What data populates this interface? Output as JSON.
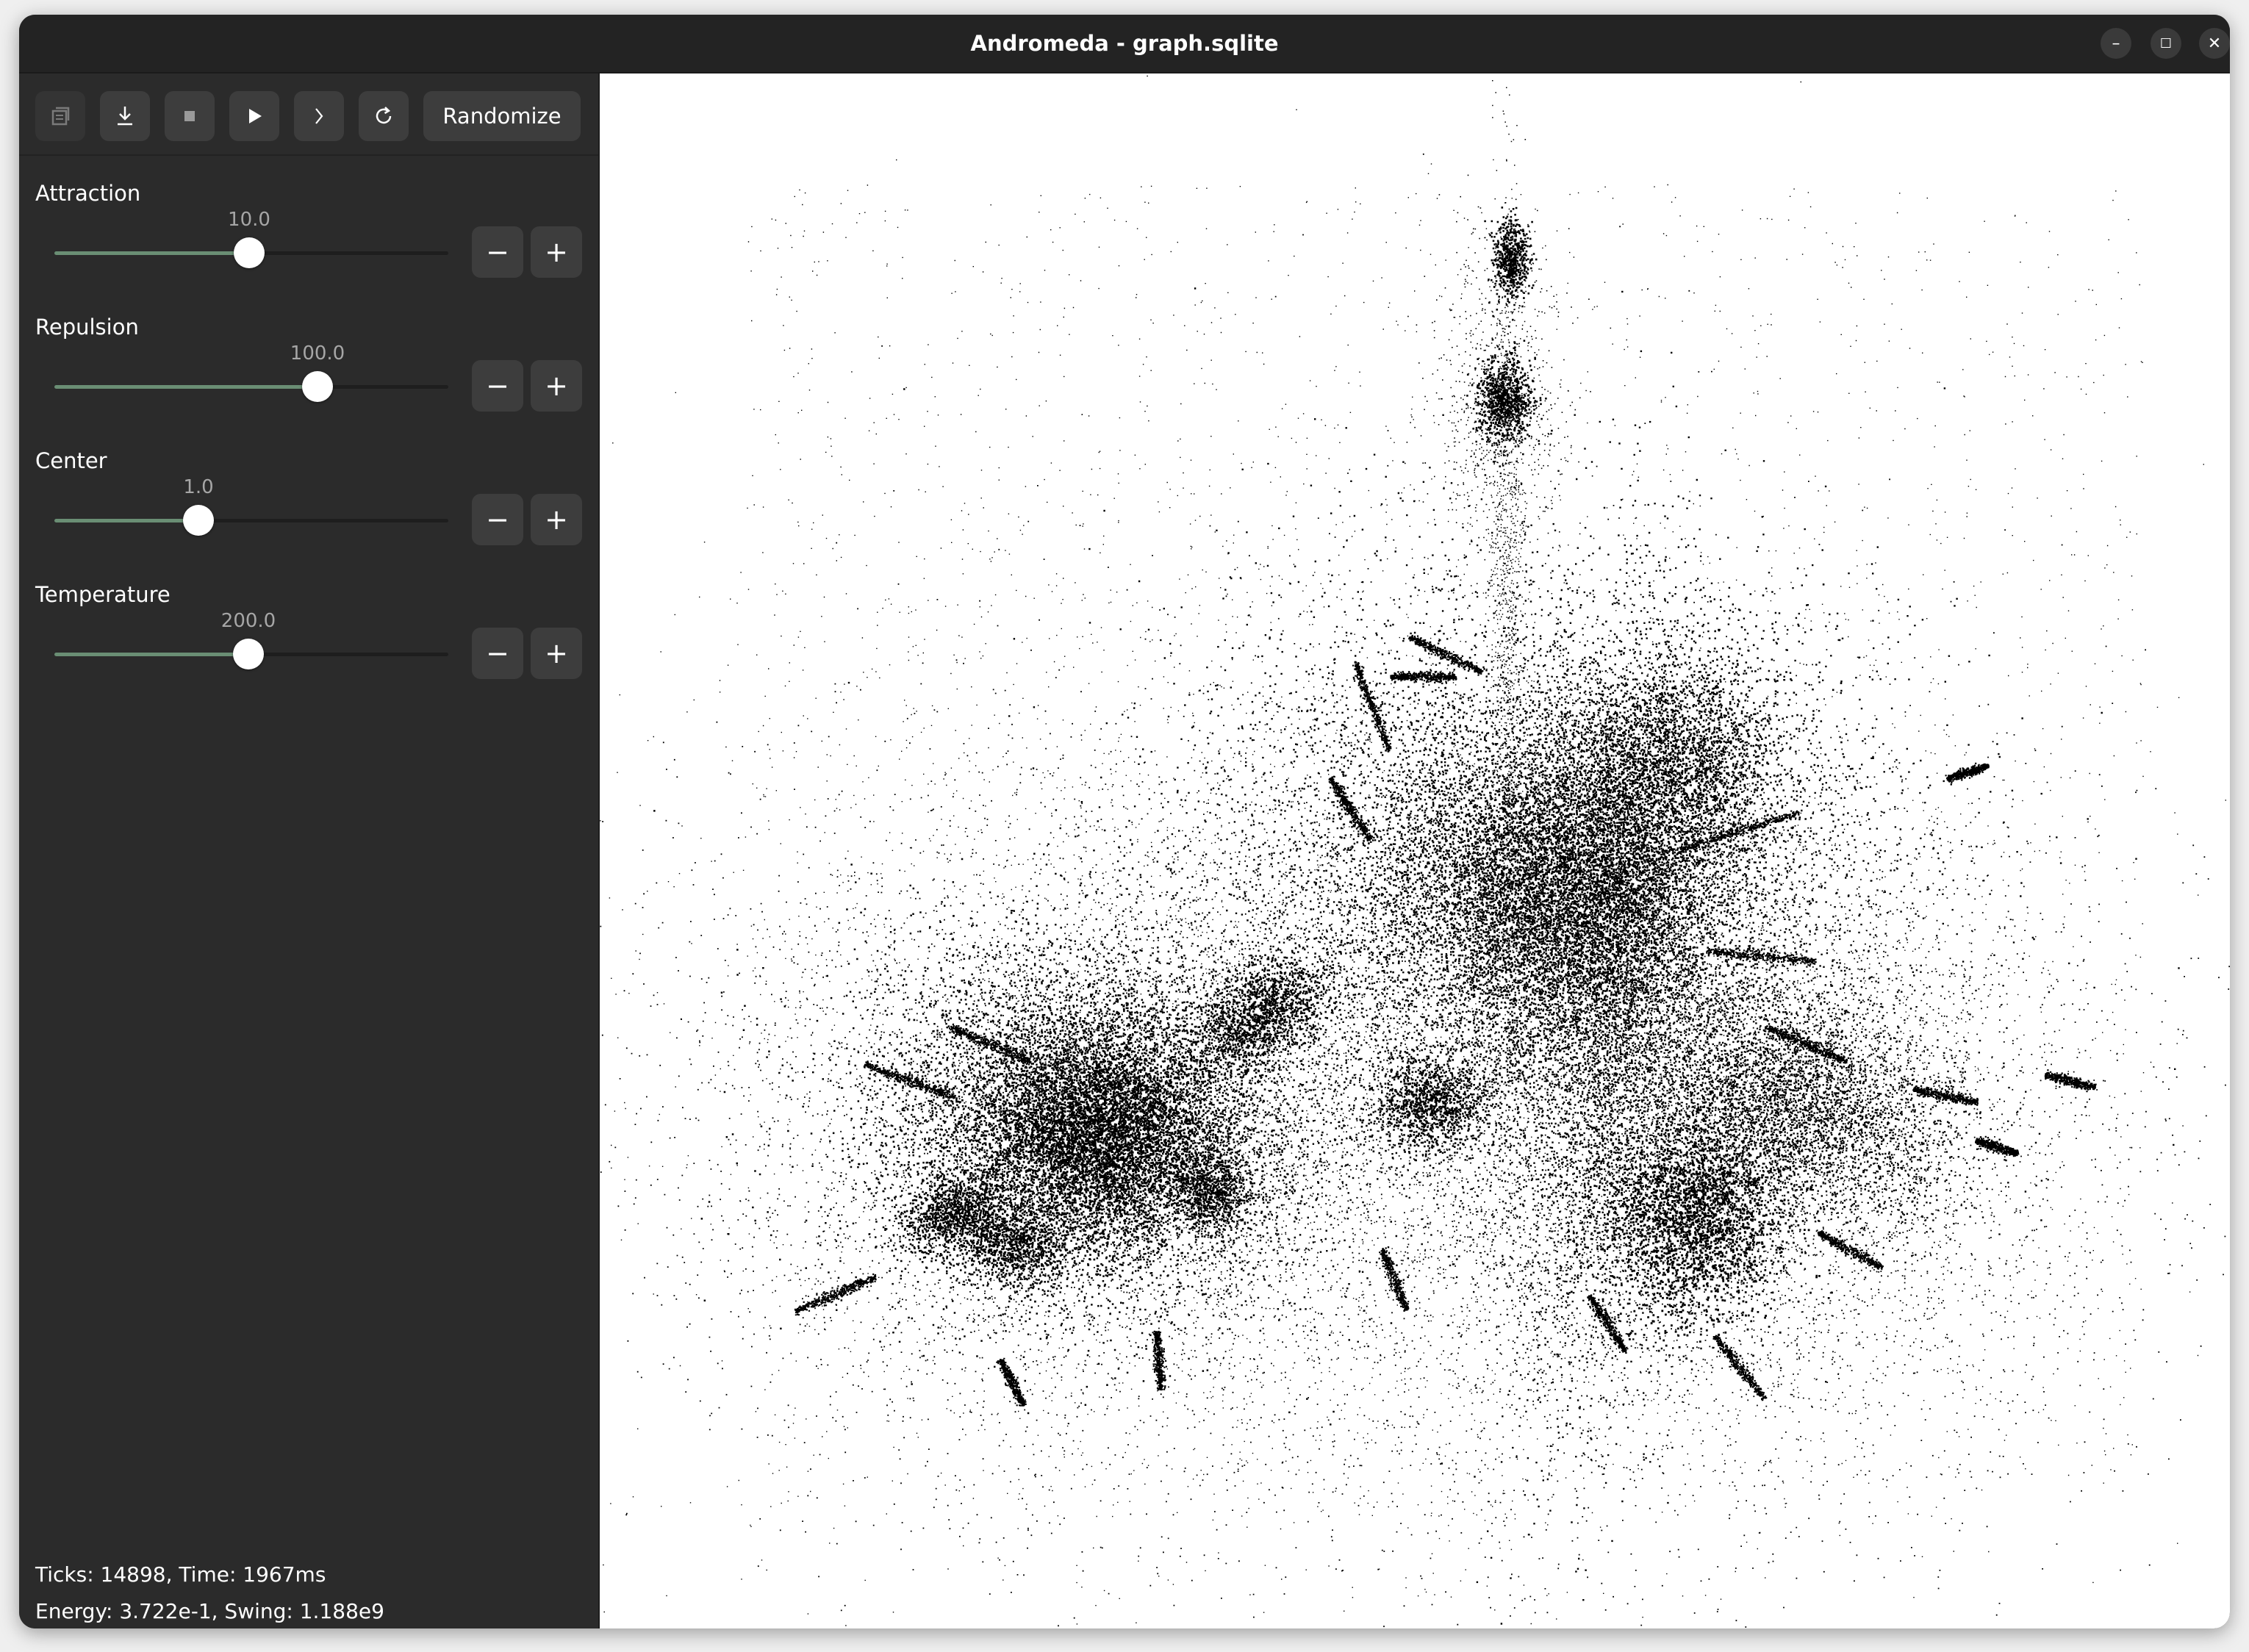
{
  "window": {
    "title": "Andromeda - graph.sqlite",
    "controls": {
      "minimize": "–",
      "maximize": "☐",
      "close": "✕"
    }
  },
  "toolbar": {
    "copy_icon": "copy-icon",
    "download_icon": "download-icon",
    "stop_icon": "stop-icon",
    "play_icon": "play-icon",
    "step_icon": "chevron-right-icon",
    "reset_icon": "refresh-icon",
    "randomize_label": "Randomize"
  },
  "params": [
    {
      "label": "Attraction",
      "value": "10.0",
      "fraction": 0.495
    },
    {
      "label": "Repulsion",
      "value": "100.0",
      "fraction": 0.667
    },
    {
      "label": "Center",
      "value": "1.0",
      "fraction": 0.366
    },
    {
      "label": "Temperature",
      "value": "200.0",
      "fraction": 0.492
    }
  ],
  "stepper": {
    "minus": "−",
    "plus": "+"
  },
  "status": {
    "line1": "Ticks: 14898, Time: 1967ms",
    "line2": "Energy: 3.722e-1, Swing: 1.188e9"
  },
  "colors": {
    "sidebar_bg": "#2b2b2b",
    "slider_fill": "#6a8e74",
    "canvas_bg": "#ffffff",
    "node": "#000000"
  }
}
